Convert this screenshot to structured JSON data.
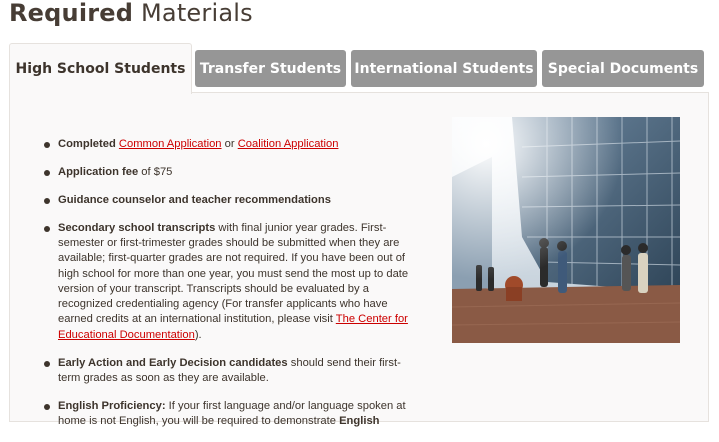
{
  "title": {
    "bold": "Required",
    "regular": "Materials"
  },
  "tabs": [
    {
      "label": "High School Students",
      "active": true
    },
    {
      "label": "Transfer Students",
      "active": false
    },
    {
      "label": "International Students",
      "active": false
    },
    {
      "label": "Special Documents",
      "active": false
    }
  ],
  "items": {
    "app": {
      "bold": "Completed",
      "link1": "Common Application",
      "mid": "or",
      "link2": "Coalition Application"
    },
    "fee": {
      "bold": "Application fee",
      "rest": "of $75"
    },
    "recs": {
      "bold": "Guidance counselor and teacher recommendations"
    },
    "transcripts": {
      "bold": "Secondary school transcripts",
      "rest": "with final junior year grades. First-semester or first-trimester grades should be submitted when they are available; first-quarter grades are not required. If you have been out of high school for more than one year, you must send the most up to date version of your transcript. Transcripts should be evaluated by a recognized credentialing agency (For transfer applicants who have earned credits at an international institution, please visit",
      "link": "The Center for Educational Documentation",
      "end": ")."
    },
    "early": {
      "bold": "Early Action and Early Decision candidates",
      "rest": "should send their first-term grades as soon as they are available."
    },
    "english": {
      "bold": "English Proficiency:",
      "rest": "If your first language and/or language spoken at home is not English, you will be required to demonstrate",
      "bold2": "English"
    }
  },
  "colors": {
    "tab_inactive": "#969696",
    "link": "#cc0000",
    "text": "#3d342c"
  }
}
